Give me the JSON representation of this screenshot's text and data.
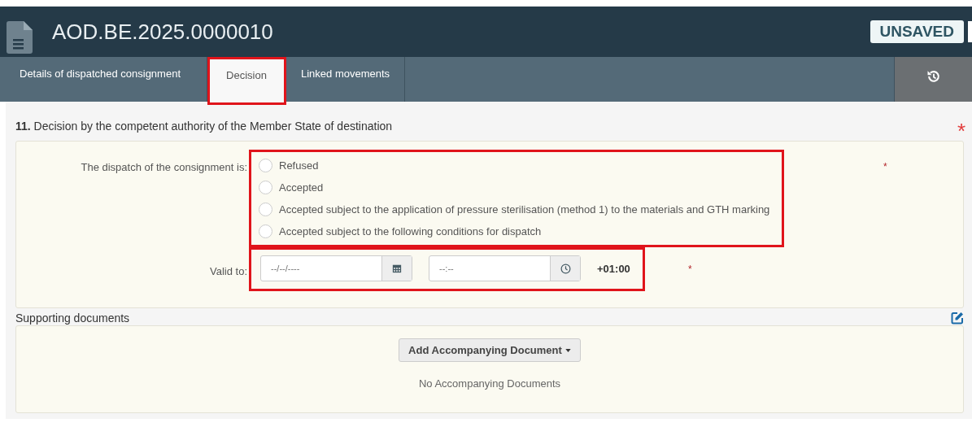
{
  "header": {
    "title": "AOD.BE.2025.0000010",
    "badge": "UNSAVED"
  },
  "tabs": [
    {
      "label": "Details of dispatched consignment",
      "selected": false,
      "highlighted": false
    },
    {
      "label": "Decision",
      "selected": true,
      "highlighted": true
    },
    {
      "label": "Linked movements",
      "selected": false,
      "highlighted": false
    }
  ],
  "section": {
    "number": "11.",
    "title": "Decision by the competent authority of the Member State of destination",
    "required_mark": "*"
  },
  "decision": {
    "label": "The dispatch of the consignment is:",
    "required_mark": "*",
    "highlighted": true,
    "options": [
      {
        "label": "Refused",
        "selected": false
      },
      {
        "label": "Accepted",
        "selected": false
      },
      {
        "label": "Accepted subject to the application of pressure sterilisation (method 1) to the materials and GTH marking",
        "selected": false
      },
      {
        "label": "Accepted subject to the following conditions for dispatch",
        "selected": false
      }
    ]
  },
  "valid_to": {
    "label": "Valid to:",
    "date_placeholder": "--/--/----",
    "time_placeholder": "--:--",
    "timezone": "+01:00",
    "required_mark": "*",
    "highlighted": true
  },
  "supporting_documents": {
    "title": "Supporting documents",
    "add_button": "Add Accompanying Document",
    "empty_text": "No Accompanying Documents"
  }
}
